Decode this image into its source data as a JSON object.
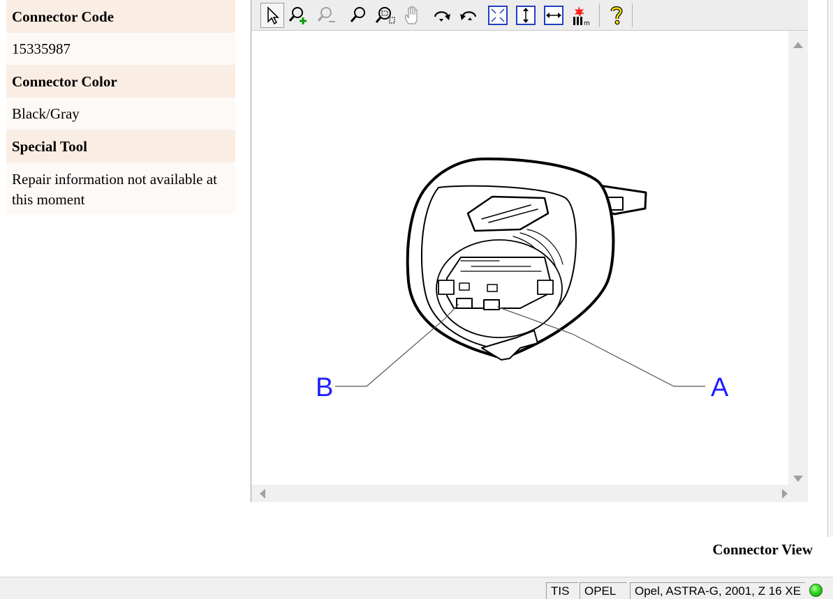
{
  "info": {
    "connector_code_label": "Connector Code",
    "connector_code_value": "15335987",
    "connector_color_label": "Connector Color",
    "connector_color_value": "Black/Gray",
    "special_tool_label": "Special Tool",
    "special_tool_value": "Repair information not available at this moment"
  },
  "toolbar": {
    "buttons": [
      "select-icon",
      "zoom-in-icon",
      "zoom-out-icon",
      "zoom-icon",
      "zoom-window-icon",
      "pan-hand-icon",
      "rotate-right-icon",
      "rotate-left-icon",
      "fit-all-icon",
      "fit-height-icon",
      "fit-width-icon",
      "highlight-icon",
      "help-icon"
    ]
  },
  "diagram": {
    "label_a": "A",
    "label_b": "B",
    "label_color": "#1e1eff"
  },
  "caption": "Connector View",
  "statusbar": {
    "app": "TIS",
    "make": "OPEL",
    "vehicle": "Opel, ASTRA-G, 2001, Z 16 XE",
    "status_color": "#2fd61f"
  }
}
